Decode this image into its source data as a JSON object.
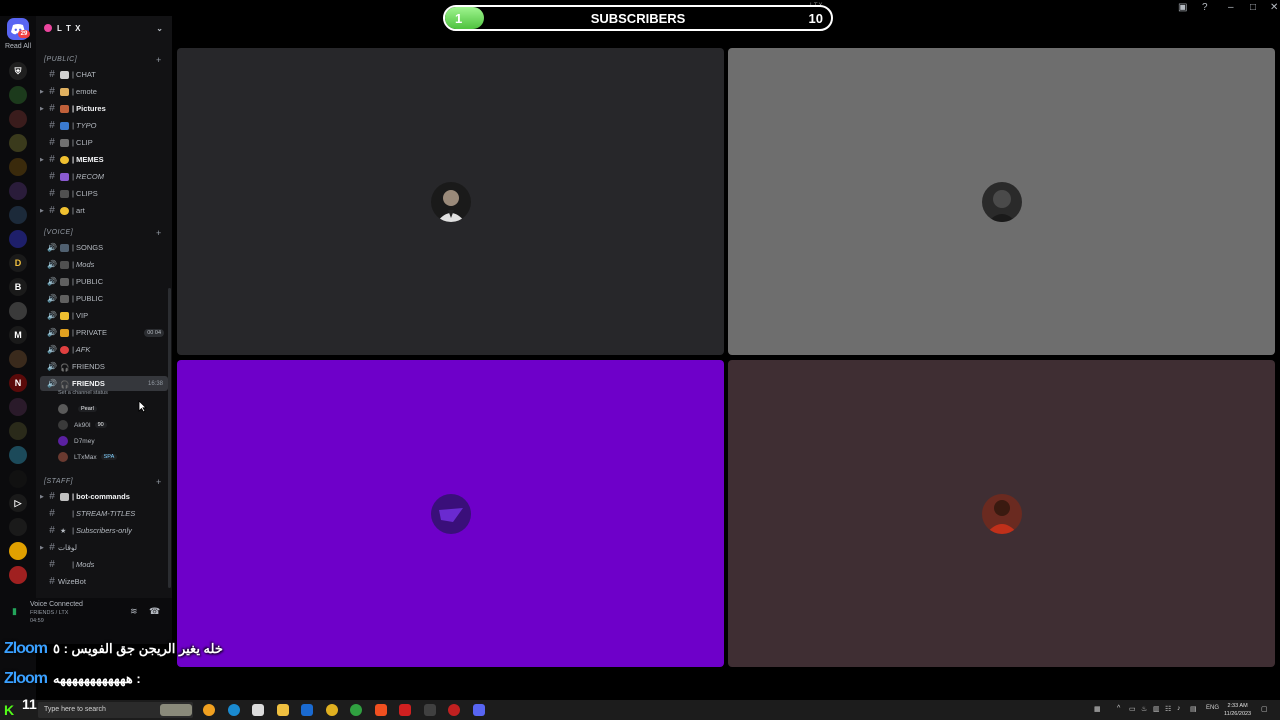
{
  "window": {
    "overlay_label": "LTX"
  },
  "rail": {
    "read_all": "Read All",
    "home_badge": "29"
  },
  "guild": {
    "name": "L T X"
  },
  "categories": {
    "public": "[PUBLIC]",
    "voice": "[VOICE]",
    "staff": "[STAFF]"
  },
  "text_channels": [
    {
      "label": "| CHAT"
    },
    {
      "label": "| emote"
    },
    {
      "label": "| Pictures"
    },
    {
      "label": "| TYPO"
    },
    {
      "label": "| CLIP"
    },
    {
      "label": "| MEMES"
    },
    {
      "label": "| RECOM"
    },
    {
      "label": "| CLIPS"
    },
    {
      "label": "| art"
    }
  ],
  "voice_channels": [
    {
      "label": "| SONGS"
    },
    {
      "label": "| Mods"
    },
    {
      "label": "| PUBLIC"
    },
    {
      "label": "| PUBLIC"
    },
    {
      "label": "| VIP"
    },
    {
      "label": "| PRIVATE",
      "pill": "00 04"
    },
    {
      "label": "| AFK"
    },
    {
      "label": "FRIENDS"
    },
    {
      "label": "FRIENDS",
      "timer": "16:38"
    }
  ],
  "channel_status_hint": "Set a channel status",
  "voice_users": [
    {
      "name": "",
      "tag": "Pearl"
    },
    {
      "name": "Ak90I",
      "tag": "90"
    },
    {
      "name": "D7mey",
      "tag": ""
    },
    {
      "name": "LTxMax",
      "tag": "SPA"
    }
  ],
  "staff_channels": [
    {
      "label": "| bot-commands"
    },
    {
      "label": "| STREAM-TITLES"
    },
    {
      "label": "| Subscribers-only"
    },
    {
      "label": "لوقات"
    },
    {
      "label": "| Mods"
    },
    {
      "label": "WizeBot"
    }
  ],
  "voice_panel": {
    "title": "Voice Connected",
    "channel": "FRIENDS / LTX",
    "time": "04:59"
  },
  "subscribers": {
    "label": "SUBSCRIBERS",
    "current": "1",
    "goal": "10",
    "progress": 0.1
  },
  "tiles": [
    {
      "bg": "#27272a",
      "av": "#1a1a1a"
    },
    {
      "bg": "#6e6e6e",
      "av": "#2a2a2a"
    },
    {
      "bg": "#6e00c9",
      "av": "#3a0f7a"
    },
    {
      "bg": "#3f2e33",
      "av": "#6a2a20"
    }
  ],
  "chat_overlay": [
    {
      "logo": "Zloom",
      "msg": "خله يغير الريجن جق الفويس : ٥"
    },
    {
      "logo": "Zloom",
      "msg": "ههههههههههههه :"
    }
  ],
  "taskbar": {
    "search_placeholder": "Type here to search",
    "counter": "11",
    "lang": "ENG",
    "time": "2:33 AM",
    "date": "11/26/2023"
  }
}
